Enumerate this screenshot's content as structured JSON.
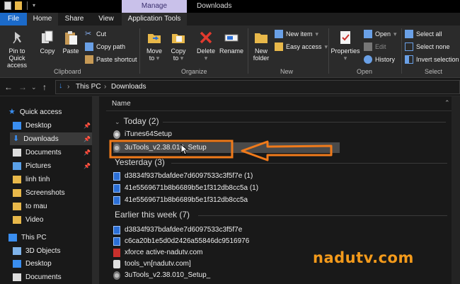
{
  "window": {
    "title": "Downloads",
    "context_tab": "Manage"
  },
  "tabs": {
    "file": "File",
    "home": "Home",
    "share": "Share",
    "view": "View",
    "app_tools": "Application Tools"
  },
  "ribbon": {
    "clipboard": {
      "pin": "Pin to Quick access",
      "copy": "Copy",
      "paste": "Paste",
      "cut": "Cut",
      "copy_path": "Copy path",
      "paste_shortcut": "Paste shortcut",
      "label": "Clipboard"
    },
    "organize": {
      "move_to": "Move to",
      "copy_to": "Copy to",
      "delete": "Delete",
      "rename": "Rename",
      "label": "Organize"
    },
    "new": {
      "new_folder": "New folder",
      "new_item": "New item",
      "easy_access": "Easy access",
      "label": "New"
    },
    "open": {
      "properties": "Properties",
      "open": "Open",
      "edit": "Edit",
      "history": "History",
      "label": "Open"
    },
    "select": {
      "select_all": "Select all",
      "select_none": "Select none",
      "invert": "Invert selection",
      "label": "Select"
    }
  },
  "address": {
    "path1": "This PC",
    "path2": "Downloads"
  },
  "sidebar": {
    "items": [
      {
        "label": "Quick access"
      },
      {
        "label": "Desktop"
      },
      {
        "label": "Downloads"
      },
      {
        "label": "Documents"
      },
      {
        "label": "Pictures"
      },
      {
        "label": "linh tinh"
      },
      {
        "label": "Screenshots"
      },
      {
        "label": "to mau"
      },
      {
        "label": "Video"
      },
      {
        "label": "This PC"
      },
      {
        "label": "3D Objects"
      },
      {
        "label": "Desktop"
      },
      {
        "label": "Documents"
      }
    ]
  },
  "columns": {
    "name": "Name"
  },
  "groups": [
    {
      "title": "Today (2)",
      "files": [
        "iTunes64Setup",
        "3uTools_v2.38.010_Setup"
      ]
    },
    {
      "title": "Yesterday (3)",
      "files": [
        "d3834f937bdafdee7d6097533c3f5f7e (1)",
        "41e5569671b8b6689b5e1f312db8cc5a (1)",
        "41e5569671b8b6689b5e1f312db8cc5a"
      ]
    },
    {
      "title": "Earlier this week (7)",
      "files": [
        "d3834f937bdafdee7d6097533c3f5f7e",
        "c6ca20b1e5d0d2426a55846dc9516976",
        "xforce active-nadutv.com",
        "tools_vn[nadutv.com]",
        "3uTools_v2.38.010_Setup_"
      ]
    }
  ],
  "watermark": "nadutv.com",
  "colors": {
    "accent": "#1b6ac9",
    "annotation": "#f07a1a",
    "watermark": "#f39a1b",
    "context_tab": "#c9c1ea"
  }
}
